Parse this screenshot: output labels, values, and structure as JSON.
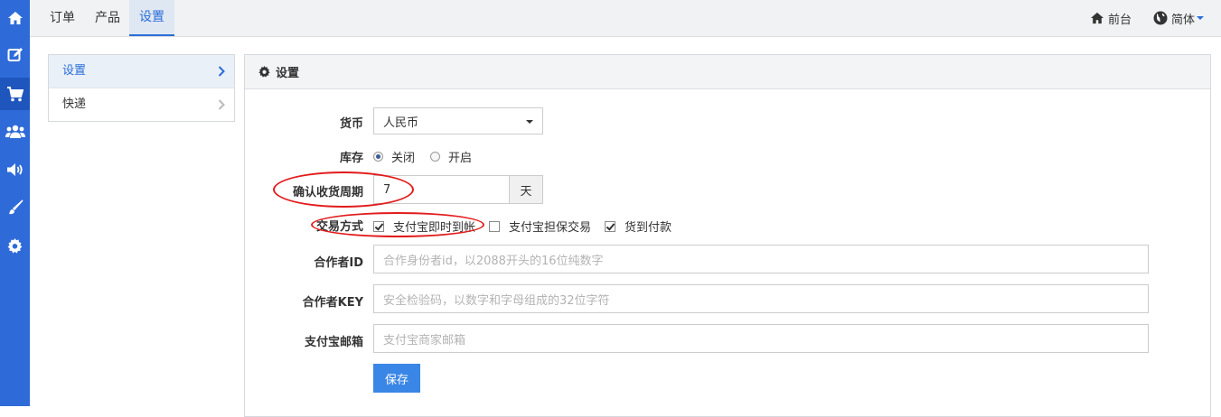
{
  "sidebar": {
    "icons": [
      "home-icon",
      "edit-icon",
      "cart-icon",
      "users-icon",
      "volume-icon",
      "brush-icon",
      "gear-icon"
    ],
    "active_index": 2,
    "color": "#2f6bd8"
  },
  "topnav": {
    "tabs": [
      {
        "label": "订单"
      },
      {
        "label": "产品"
      },
      {
        "label": "设置"
      }
    ],
    "active_tab": "设置",
    "frontend_label": "前台",
    "language_label": "简体"
  },
  "subnav": {
    "items": [
      {
        "label": "设置"
      },
      {
        "label": "快递"
      }
    ]
  },
  "panel": {
    "title": "设置"
  },
  "form": {
    "currency": {
      "label": "货币",
      "value": "人民币"
    },
    "stock": {
      "label": "库存",
      "option_off": "关闭",
      "option_on": "开启",
      "selected": "关闭"
    },
    "confirm_period": {
      "label": "确认收货周期",
      "value": "7",
      "unit": "天"
    },
    "payment": {
      "label": "交易方式",
      "options": [
        {
          "label": "支付宝即时到帐",
          "checked": true
        },
        {
          "label": "支付宝担保交易",
          "checked": false
        },
        {
          "label": "货到付款",
          "checked": true
        }
      ]
    },
    "partner_id": {
      "label": "合作者ID",
      "placeholder": "合作身份者id，以2088开头的16位纯数字"
    },
    "partner_key": {
      "label": "合作者KEY",
      "placeholder": "安全检验码，以数字和字母组成的32位字符"
    },
    "alipay_email": {
      "label": "支付宝邮箱",
      "placeholder": "支付宝商家邮箱"
    },
    "save_label": "保存"
  },
  "colors": {
    "accent": "#2a6ed8",
    "button": "#3a86e6",
    "annotation": "#e21b1b"
  }
}
